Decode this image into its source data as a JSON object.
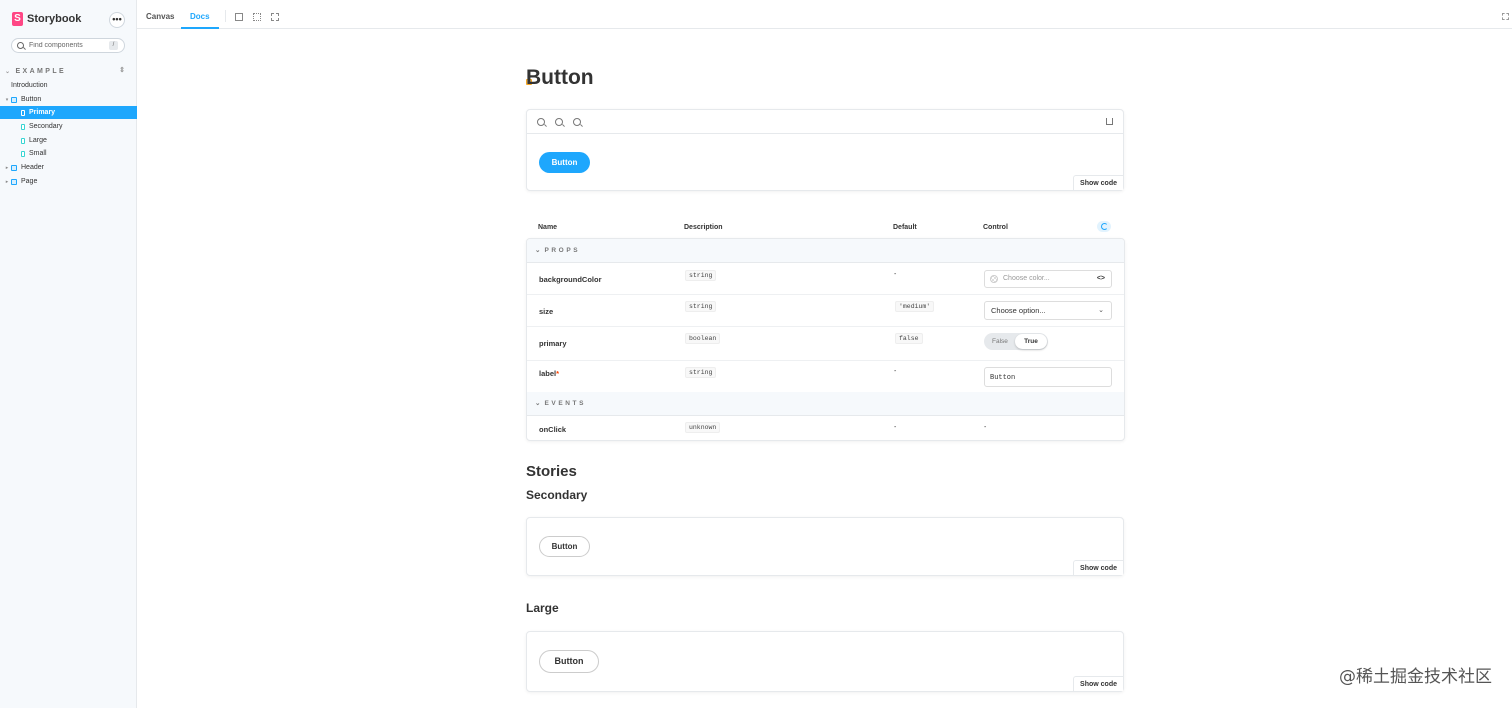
{
  "sidebar": {
    "brand": "Storybook",
    "menu_label": "•••",
    "search_placeholder": "Find components",
    "search_shortcut": "/",
    "group_label": "EXAMPLE",
    "items": [
      {
        "label": "Introduction",
        "kind": "doc"
      },
      {
        "label": "Button",
        "kind": "component",
        "expanded": true
      },
      {
        "label": "Primary",
        "kind": "story",
        "selected": true
      },
      {
        "label": "Secondary",
        "kind": "story"
      },
      {
        "label": "Large",
        "kind": "story"
      },
      {
        "label": "Small",
        "kind": "story"
      },
      {
        "label": "Header",
        "kind": "component",
        "expanded": false
      },
      {
        "label": "Page",
        "kind": "component",
        "expanded": false
      }
    ],
    "accent_color": "#1ea7fd"
  },
  "toolbar": {
    "tabs": [
      {
        "label": "Canvas",
        "active": false
      },
      {
        "label": "Docs",
        "active": true
      }
    ],
    "icons": [
      "grid-icon",
      "outline-icon",
      "measure-icon"
    ]
  },
  "doc": {
    "title": "Button",
    "primary_preview": {
      "button_label": "Button",
      "show_code": "Show code"
    },
    "args_table": {
      "headers": [
        "Name",
        "Description",
        "Default",
        "Control"
      ],
      "sections": {
        "props": "PROPS",
        "events": "EVENTS"
      },
      "rows": [
        {
          "name": "backgroundColor",
          "type": "string",
          "default": "-",
          "control_placeholder": "Choose color...",
          "control_toggle": "<>"
        },
        {
          "name": "size",
          "type": "string",
          "default": "'medium'",
          "control_value": "Choose option..."
        },
        {
          "name": "primary",
          "type": "boolean",
          "default": "false",
          "toggle_false": "False",
          "toggle_true": "True"
        },
        {
          "name": "label",
          "required_mark": "*",
          "type": "string",
          "default": "-",
          "control_value": "Button"
        },
        {
          "name": "onClick",
          "type": "unknown",
          "default": "-",
          "control_value": "-"
        }
      ]
    },
    "stories_heading": "Stories",
    "stories": [
      {
        "title": "Secondary",
        "button_label": "Button",
        "show_code": "Show code"
      },
      {
        "title": "Large",
        "button_label": "Button",
        "show_code": "Show code"
      }
    ]
  },
  "watermark": "@稀土掘金技术社区"
}
